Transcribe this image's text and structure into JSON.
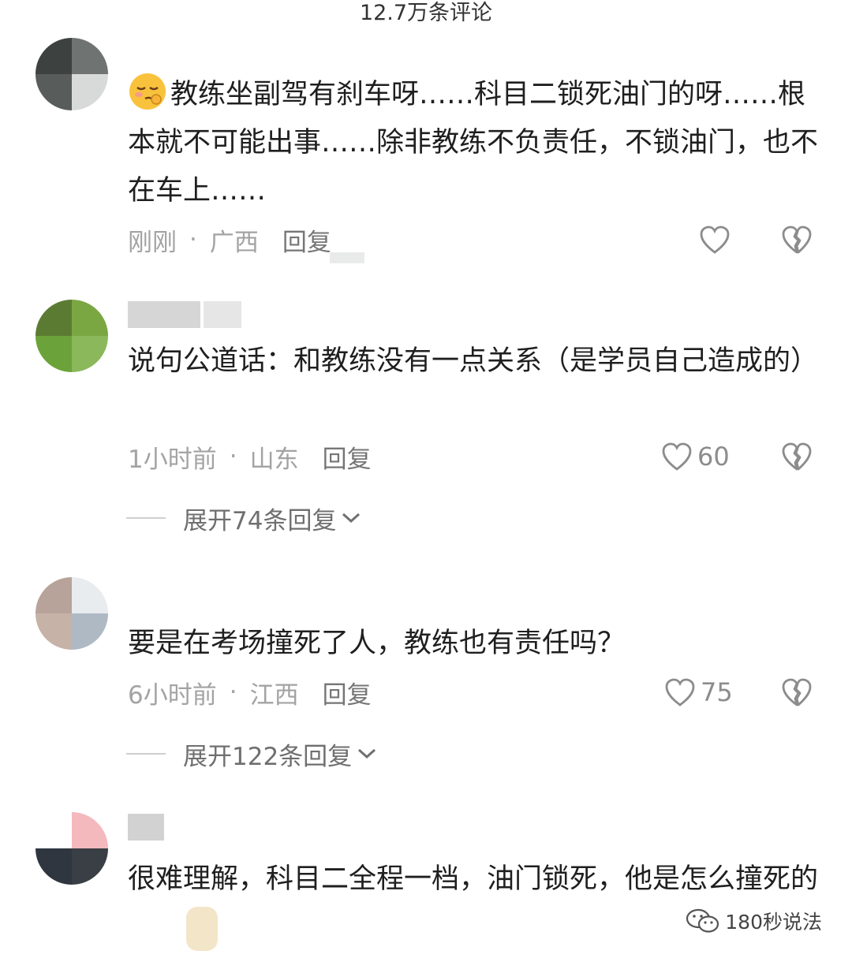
{
  "header": {
    "comment_count": "12.7万条评论"
  },
  "comments": [
    {
      "text": "教练坐副驾有刹车呀……科目二锁死油门的呀……根本就不可能出事……除非教练不负责任，不锁油门，也不在车上……",
      "time": "刚刚",
      "location": "广西",
      "reply_label": "回复",
      "likes": "",
      "emoji": "relieved-face-emoji"
    },
    {
      "text": "说句公道话：和教练没有一点关系（是学员自己造成的）",
      "time": "1小时前",
      "location": "山东",
      "reply_label": "回复",
      "likes": "60",
      "expand_label": "展开74条回复"
    },
    {
      "text": "要是在考场撞死了人，教练也有责任吗？",
      "time": "6小时前",
      "location": "江西",
      "reply_label": "回复",
      "likes": "75",
      "expand_label": "展开122条回复"
    },
    {
      "text": "很难理解，科目二全程一档，油门锁死，他是怎么撞死的",
      "time": "",
      "location": "",
      "reply_label": ""
    }
  ],
  "icons": {
    "like": "heart-outline-icon",
    "dislike": "broken-heart-icon",
    "expand": "chevron-down-icon",
    "watermark": "wechat-icon"
  },
  "watermark": {
    "label": "180秒说法"
  },
  "colors": {
    "text": "#1f1f1f",
    "meta": "#a3a3a3",
    "reply": "#767676",
    "icon": "#8c8c8c"
  }
}
